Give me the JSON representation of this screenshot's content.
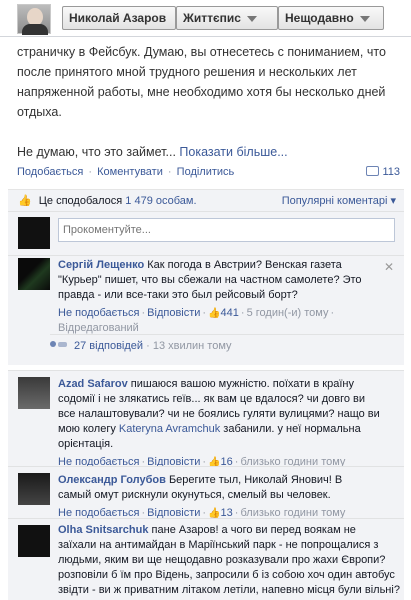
{
  "topbar": {
    "profile_name": "Николай Азаров",
    "timeline_label": "Життєпис",
    "recent_label": "Нещодавно"
  },
  "post": {
    "line1": "страничку в Фейсбук. Думаю, вы отнесетесь с пониманием, что",
    "line2": "после принятого мной трудного решения и нескольких лет",
    "line3": "напряженной работы, мне необходимо хотя бы несколько дней",
    "line4": "отдыха.",
    "line5": "Не думаю, что это займет...",
    "show_more": "Показати більше..."
  },
  "actions": {
    "like": "Подобається",
    "comment": "Коментувати",
    "share": "Поділитись",
    "shares_count": "113"
  },
  "likes": {
    "text_prefix": "Це сподобалося",
    "count_text": "1 479 особам.",
    "sort": "Популярні коментарі ▾"
  },
  "comment_input": {
    "placeholder": "Прокоментуйте..."
  },
  "comments": [
    {
      "author": "Сергiй Лещенко",
      "text": "Как погода в Австрии? Венская газета \"Курьер\" пишет, что вы сбежали на частном самолете? Это правда - или все-таки это был рейсовый борт?",
      "unlike": "Не подобається",
      "reply": "Відповісти",
      "likes": "441",
      "time": "5 годин(-и) тому",
      "edited": "Відредагований",
      "replies_text": "27 відповідей",
      "replies_time": "13 хвилин тому"
    },
    {
      "author": "Azad Safarov",
      "text_a": "пишаюся вашою мужністю. поїхати в країну содомії і не злякатись геїв... як вам це вдалося? чи довго ви мою колегу",
      "text_line1": "пишаюся вашою мужністю. поїхати в країну",
      "text_line2": "содомії і не злякатись геїв... як вам це вдалося? чи довго ви",
      "text_line3": "все налаштовували? чи не боялись гуляти вулицями? нащо ви",
      "text_line4_prefix": "мою колегу",
      "mention": "Kateryna Avramchuk",
      "text_line4_suffix": "забанили. у неї нормальна",
      "text_line5": "орієнтація.",
      "unlike": "Не подобається",
      "reply": "Відповісти",
      "likes": "16",
      "time": "близько години тому"
    },
    {
      "author": "Олександр Голубов",
      "text_line1": "Берегите тыл, Николай Янович! В",
      "text_line2": "самый омут рискнули окунуться, смелый вы человек.",
      "unlike": "Не подобається",
      "reply": "Відповісти",
      "likes": "13",
      "time": "близько години тому"
    },
    {
      "author": "Olha Snitsarchuk",
      "text_line1": "пане Азаров! а чого ви перед воякам не",
      "text_line2": "заїхали на антимайдан в Маріїнський парк - не попрощалися з",
      "text_line3": "людьми, яким ви ще нещодавно розказували про жахи Європи?",
      "text_line4": "розповіли б їм про Відень, запросили б із собою хоч один автобус",
      "text_line5": "звідти - ви ж приватним літаком летіли, напевно місця були вільні?"
    }
  ],
  "colors": {
    "link": "#3b5998",
    "comment_bg": "#f2f3f6",
    "meta_grey": "#9197a3"
  }
}
